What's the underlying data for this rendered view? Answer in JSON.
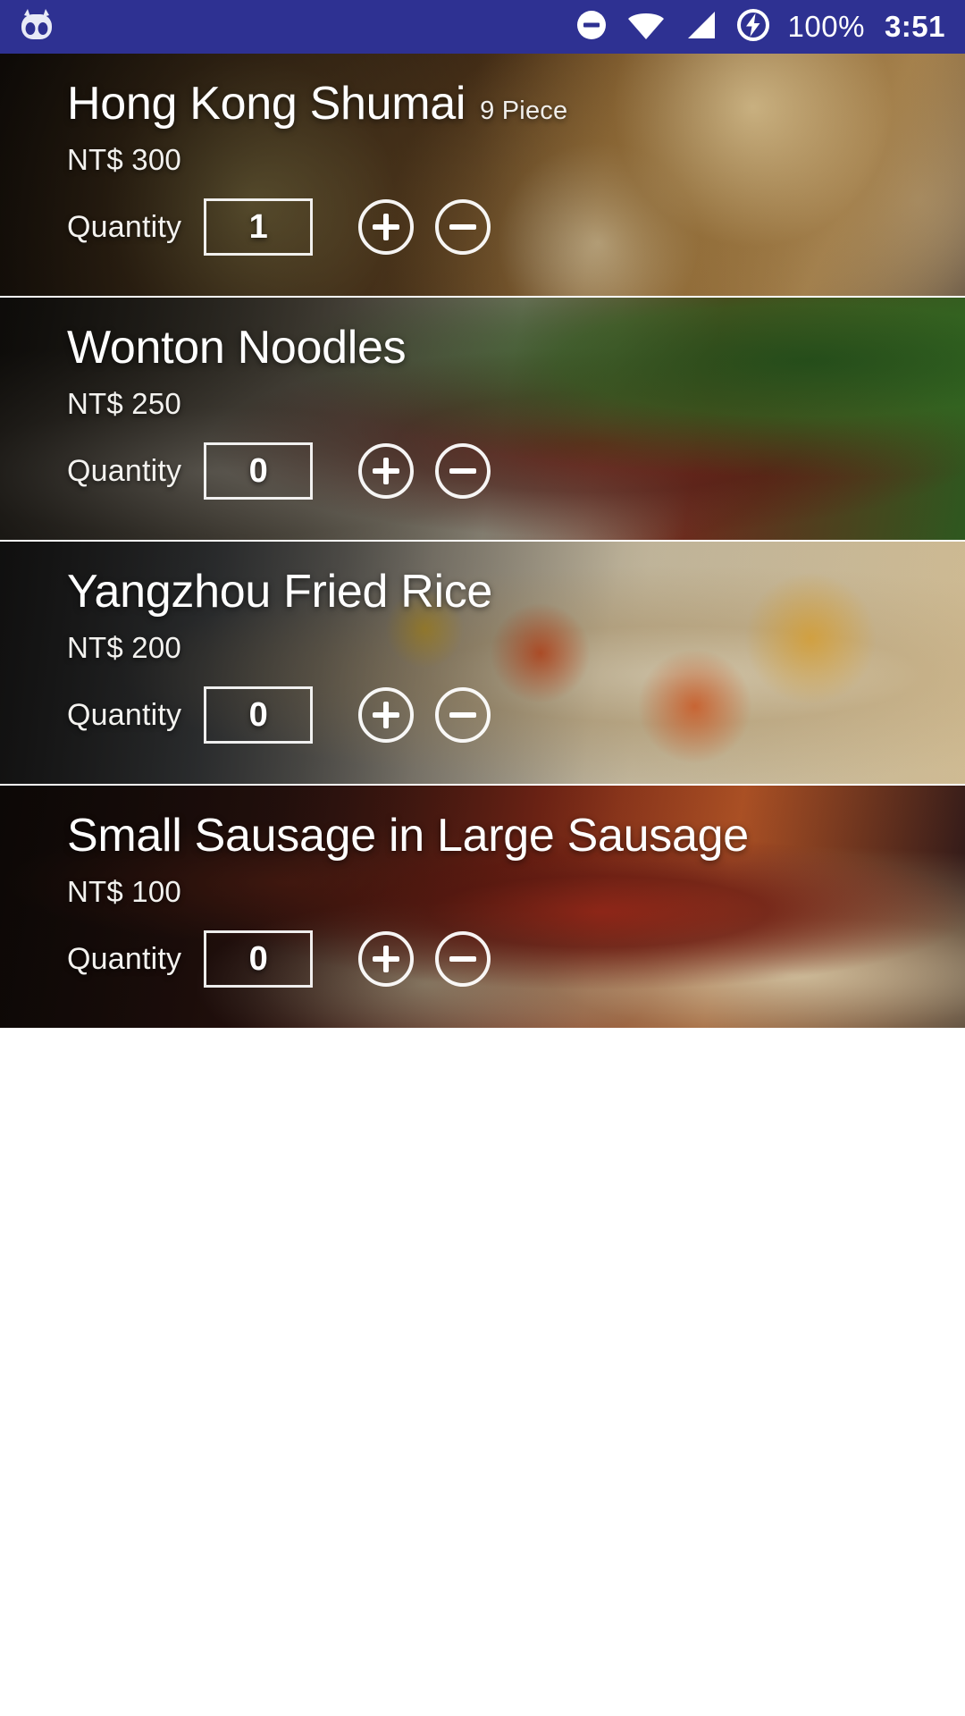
{
  "status_bar": {
    "background_color": "#2e3192",
    "logo_icon": "cyanogenmod-logo-icon",
    "icons": [
      {
        "name": "do-not-disturb-icon",
        "label": "Do not disturb"
      },
      {
        "name": "wifi-icon",
        "label": "Wi-Fi"
      },
      {
        "name": "cellular-signal-icon",
        "label": "Cellular signal"
      },
      {
        "name": "battery-charging-icon",
        "label": "Charging"
      }
    ],
    "battery_percent": "100%",
    "clock": "3:51"
  },
  "menu": {
    "quantity_label": "Quantity",
    "increase_label": "+",
    "decrease_label": "−",
    "items": [
      {
        "name": "Hong Kong Shumai",
        "subtitle": "9 Piece",
        "price": "NT$ 300",
        "quantity": "1"
      },
      {
        "name": "Wonton Noodles",
        "subtitle": "",
        "price": "NT$ 250",
        "quantity": "0"
      },
      {
        "name": "Yangzhou Fried Rice",
        "subtitle": "",
        "price": "NT$ 200",
        "quantity": "0"
      },
      {
        "name": "Small Sausage in Large Sausage",
        "subtitle": "",
        "price": "NT$ 100",
        "quantity": "0"
      }
    ]
  }
}
